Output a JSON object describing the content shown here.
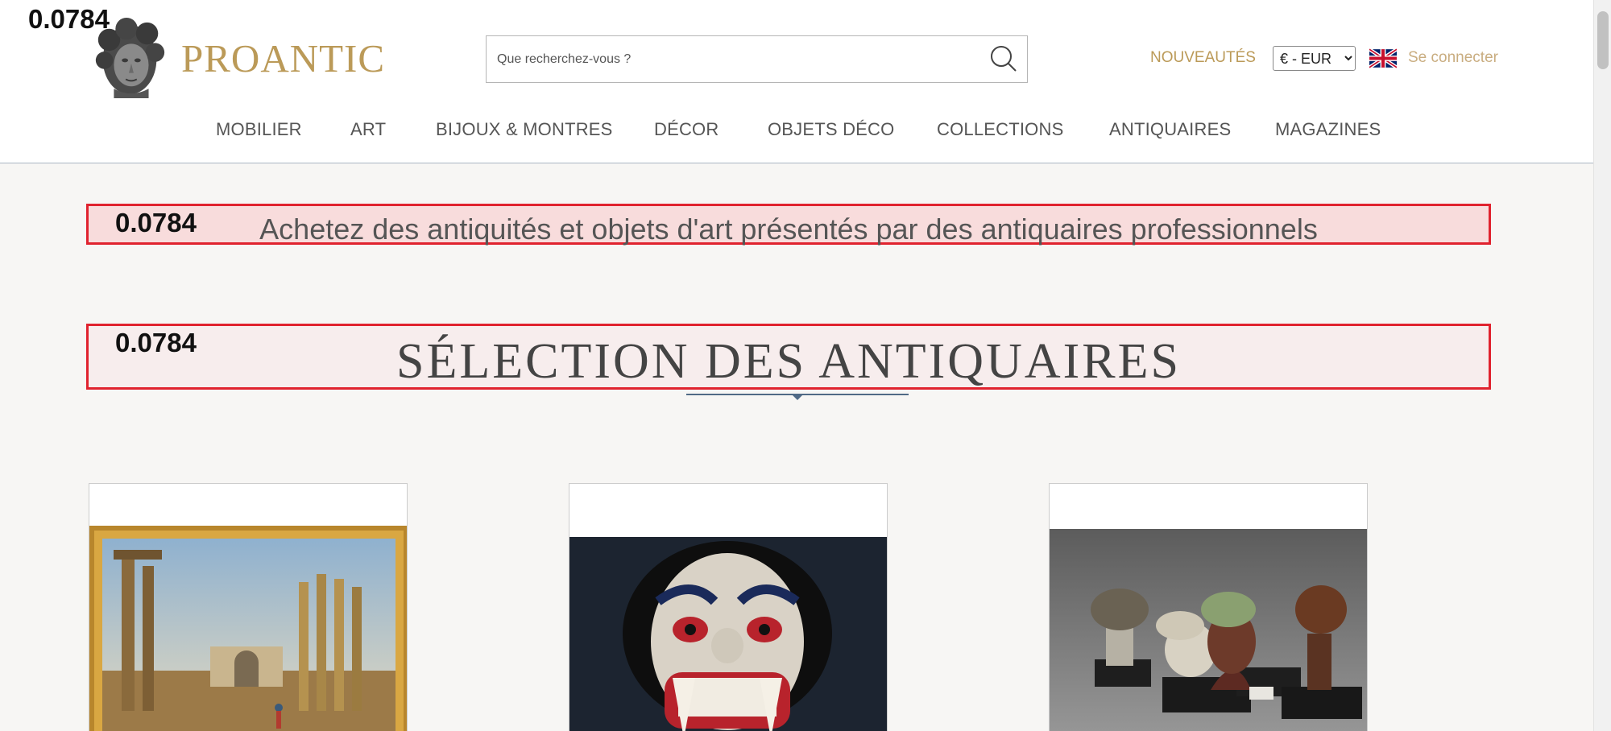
{
  "scores": {
    "top": "0.0784",
    "tagline": "0.0784",
    "selection": "0.0784"
  },
  "header": {
    "brand": "PROANTIC",
    "search": {
      "placeholder": "Que recherchez-vous ?"
    },
    "new_label": "NOUVEAUTÉS",
    "currency": {
      "selected": "€ - EUR"
    },
    "login_label": "Se connecter"
  },
  "nav": {
    "items": [
      "MOBILIER",
      "ART",
      "BIJOUX & MONTRES",
      "DÉCOR",
      "OBJETS DÉCO",
      "COLLECTIONS",
      "ANTIQUAIRES",
      "MAGAZINES"
    ]
  },
  "tagline": "Achetez des antiquités et objets d'art présentés par des antiquaires professionnels",
  "selection_title": "SÉLECTION DES ANTIQUAIRES",
  "colors": {
    "brand_gold": "#bb9a58",
    "highlight_red": "#e0222e",
    "divider_blue": "#506a86"
  }
}
